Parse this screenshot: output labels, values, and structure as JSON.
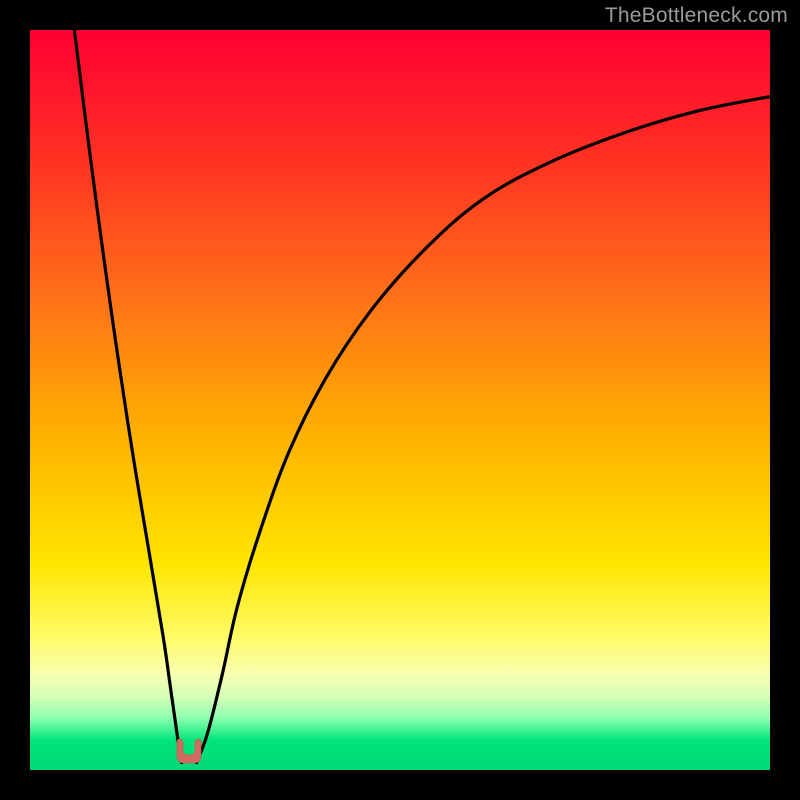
{
  "watermark": "TheBottleneck.com",
  "colors": {
    "frame": "#000000",
    "curve": "#000000",
    "marker_fill": "#d26a60",
    "gradient_top": "#ff0033",
    "gradient_bottom": "#00d877"
  },
  "chart_data": {
    "type": "line",
    "title": "",
    "xlabel": "",
    "ylabel": "",
    "xlim": [
      0,
      100
    ],
    "ylim": [
      0,
      100
    ],
    "grid": false,
    "legend": false,
    "annotations": [
      "TheBottleneck.com"
    ],
    "series": [
      {
        "name": "left_branch",
        "x": [
          6,
          8,
          10,
          12,
          14,
          16,
          18,
          19,
          20,
          20.5
        ],
        "y": [
          100,
          84,
          69,
          55,
          42,
          30,
          18,
          11,
          4,
          1
        ]
      },
      {
        "name": "right_branch",
        "x": [
          22.5,
          24,
          26,
          28,
          31,
          35,
          40,
          46,
          53,
          61,
          70,
          80,
          90,
          100
        ],
        "y": [
          1,
          5,
          13,
          22,
          32,
          43,
          53,
          62,
          70,
          77,
          82,
          86,
          89,
          91
        ]
      }
    ],
    "marker": {
      "x": 21.5,
      "y": 1,
      "shape": "u_notch"
    }
  }
}
